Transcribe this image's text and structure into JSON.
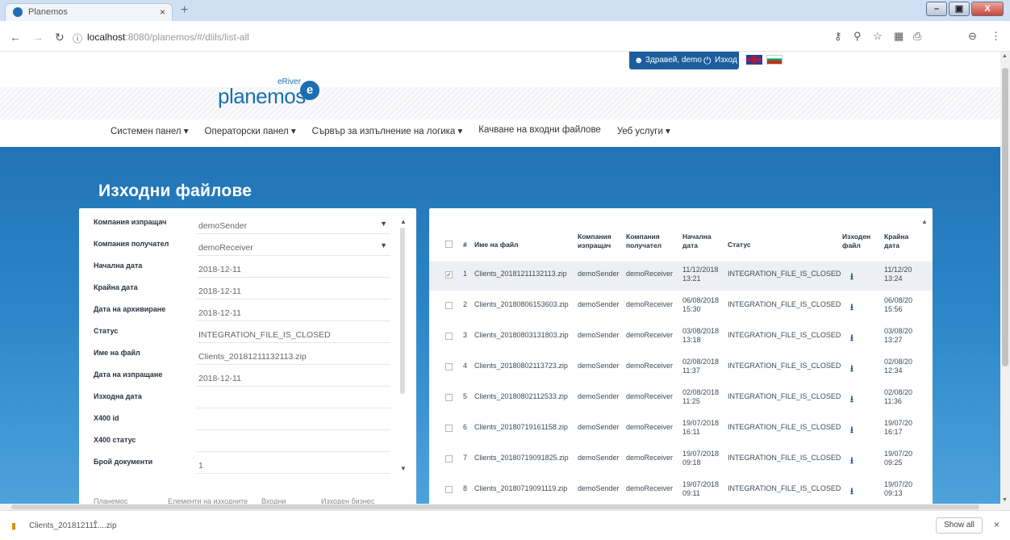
{
  "browser": {
    "tab_title": "Planemos",
    "tab_close": "×",
    "new_tab": "+",
    "url_host": "localhost",
    "url_port": ":8080",
    "url_path": "/planemos/#/dlils/list-all",
    "win_minimize": "–",
    "win_maximize": "▣",
    "win_close": "X"
  },
  "topbar": {
    "greeting": "Здравей, demo",
    "logout": "Изход"
  },
  "logo": {
    "eriver": "eRiver",
    "wordmark": "planemos",
    "mark": "e"
  },
  "menu": {
    "items": [
      "Системен панел ▾",
      "Операторски панел ▾",
      "Сървър за изпълнение на логика ▾",
      "Качване на входни файлове",
      "Уеб услуги ▾"
    ]
  },
  "page_title": "Изходни файлове",
  "details": {
    "fields": [
      {
        "label": "Компания изпращач",
        "value": "demoSender",
        "dropdown": true
      },
      {
        "label": "Компания получател",
        "value": "demoReceiver",
        "dropdown": true
      },
      {
        "label": "Начална дата",
        "value": "2018-12-11"
      },
      {
        "label": "Крайна дата",
        "value": "2018-12-11"
      },
      {
        "label": "Дата на архивиране",
        "value": "2018-12-11"
      },
      {
        "label": "Статус",
        "value": "INTEGRATION_FILE_IS_CLOSED"
      },
      {
        "label": "Име на файл",
        "value": "Clients_20181211132113.zip"
      },
      {
        "label": "Дата на изпращане",
        "value": "2018-12-11"
      },
      {
        "label": "Изходна дата",
        "value": ""
      },
      {
        "label": "X400 id",
        "value": ""
      },
      {
        "label": "X400 статус",
        "value": ""
      },
      {
        "label": "Брой документи",
        "value": "1"
      }
    ],
    "bottom_tabs": [
      "Планемос",
      "Елементи на изходните",
      "Входни",
      "Изходен бизнес"
    ]
  },
  "table": {
    "headers": {
      "num": "#",
      "filename": "Име на файл",
      "sender": "Компания изпращач",
      "receiver": "Компания получател",
      "start": "Начална дата",
      "status": "Статус",
      "outfile": "Изходен файл",
      "end": "Крайна дата"
    },
    "rows": [
      {
        "num": "1",
        "file": "Clients_20181211132113.zip",
        "sender": "demoSender",
        "receiver": "demoReceiver",
        "start": "11/12/2018 13:21",
        "status": "INTEGRATION_FILE_IS_CLOSED",
        "end": "11/12/20 13:24",
        "checked": true
      },
      {
        "num": "2",
        "file": "Clients_20180806153603.zip",
        "sender": "demoSender",
        "receiver": "demoReceiver",
        "start": "06/08/2018 15:30",
        "status": "INTEGRATION_FILE_IS_CLOSED",
        "end": "06/08/20 15:56",
        "checked": false
      },
      {
        "num": "3",
        "file": "Clients_20180803131803.zip",
        "sender": "demoSender",
        "receiver": "demoReceiver",
        "start": "03/08/2018 13:18",
        "status": "INTEGRATION_FILE_IS_CLOSED",
        "end": "03/08/20 13:27",
        "checked": false
      },
      {
        "num": "4",
        "file": "Clients_20180802113723.zip",
        "sender": "demoSender",
        "receiver": "demoReceiver",
        "start": "02/08/2018 11:37",
        "status": "INTEGRATION_FILE_IS_CLOSED",
        "end": "02/08/20 12:34",
        "checked": false
      },
      {
        "num": "5",
        "file": "Clients_20180802112533.zip",
        "sender": "demoSender",
        "receiver": "demoReceiver",
        "start": "02/08/2018 11:25",
        "status": "INTEGRATION_FILE_IS_CLOSED",
        "end": "02/08/20 11:36",
        "checked": false
      },
      {
        "num": "6",
        "file": "Clients_20180719161158.zip",
        "sender": "demoSender",
        "receiver": "demoReceiver",
        "start": "19/07/2018 16:11",
        "status": "INTEGRATION_FILE_IS_CLOSED",
        "end": "19/07/20 16:17",
        "checked": false
      },
      {
        "num": "7",
        "file": "Clients_20180719091825.zip",
        "sender": "demoSender",
        "receiver": "demoReceiver",
        "start": "19/07/2018 09:18",
        "status": "INTEGRATION_FILE_IS_CLOSED",
        "end": "19/07/20 09:25",
        "checked": false
      },
      {
        "num": "8",
        "file": "Clients_20180719091119.zip",
        "sender": "demoSender",
        "receiver": "demoReceiver",
        "start": "19/07/2018 09:11",
        "status": "INTEGRATION_FILE_IS_CLOSED",
        "end": "19/07/20 09:13",
        "checked": false
      }
    ]
  },
  "downloads": {
    "file": "Clients_201812111....zip",
    "show_all": "Show all",
    "close": "×"
  },
  "icons": {
    "download": "⭳",
    "checkmark": "✓"
  },
  "colors": {
    "brand_blue": "#1b6fb0",
    "hero_blue": "#2273b5",
    "topbar_blue": "#1b5e9e"
  }
}
